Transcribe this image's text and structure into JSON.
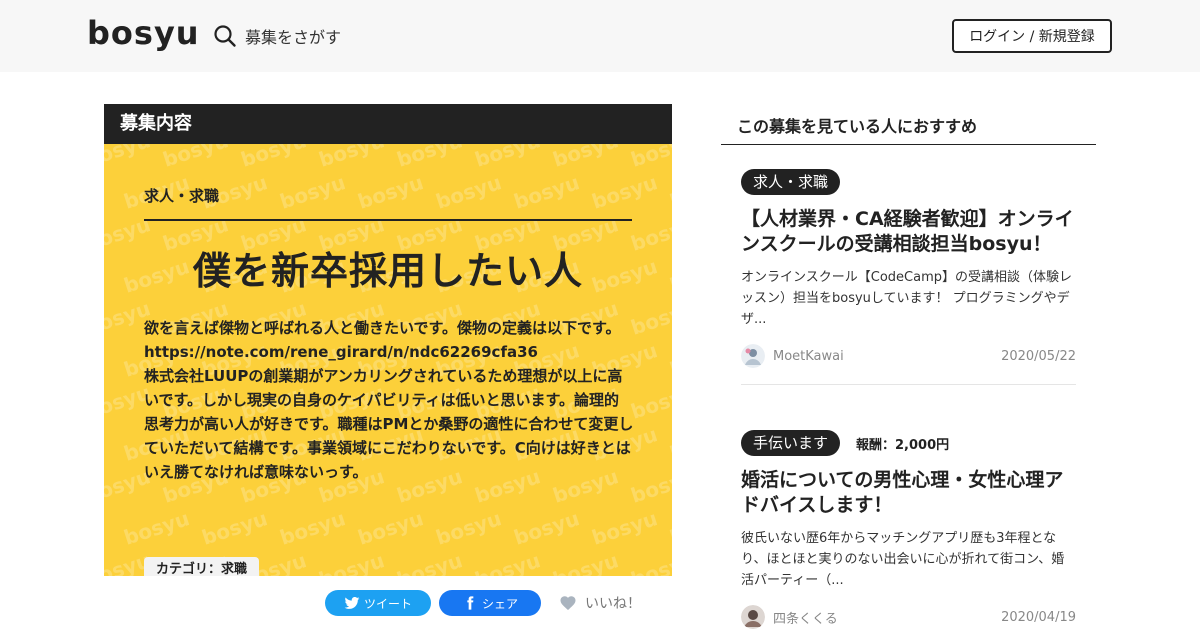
{
  "header": {
    "logo": "bosyu",
    "search_label": "募集をさがす",
    "login_label": "ログイン / 新規登録"
  },
  "card": {
    "section_title": "募集内容",
    "watermark": "bosyu",
    "category": "求人・求職",
    "title": "僕を新卒採用したい人",
    "description": "欲を言えば傑物と呼ばれる人と働きたいです。傑物の定義は以下です。\nhttps://note.com/rene_girard/n/ndc62269cfa36\n株式会社LUUPの創業期がアンカリングされているため理想が以上に高いです。しかし現実の自身のケイパビリティは低いと思います。論理的思考力が高い人が好きです。職種はPMとか桑野の適性に合わせて変更していただいて結構です。事業領域にこだわりないです。C向けは好きとはいえ勝てなければ意味ないっす。",
    "tag": "カテゴリ：求職"
  },
  "share": {
    "tweet_label": "ツイート",
    "share_label": "シェア",
    "like_label": "いいね！"
  },
  "sidebar": {
    "title": "この募集を見ている人におすすめ",
    "items": [
      {
        "badge": "求人・求職",
        "reward": "",
        "title": "【人材業界・CA経験者歓迎】オンラインスクールの受講相談担当bosyu！",
        "description": "オンラインスクール【CodeCamp】の受講相談（体験レッスン）担当をbosyuしています！ プログラミングやデザ...",
        "user": "MoetKawai",
        "date": "2020/05/22"
      },
      {
        "badge": "手伝います",
        "reward": "報酬：2,000円",
        "title": "婚活についての男性心理・女性心理アドバイスします！",
        "description": "彼氏いない歴6年からマッチングアプリ歴も3年程となり、ほとほと実りのない出会いに心が折れて街コン、婚活パーティー（...",
        "user": "四条くくる",
        "date": "2020/04/19"
      }
    ]
  },
  "colors": {
    "card_yellow": "#fcd03a",
    "twitter_blue": "#1da1f2",
    "facebook_blue": "#1877f2",
    "dark": "#222222"
  },
  "icons": [
    "search-icon",
    "twitter-icon",
    "facebook-icon",
    "heart-icon",
    "avatar"
  ]
}
